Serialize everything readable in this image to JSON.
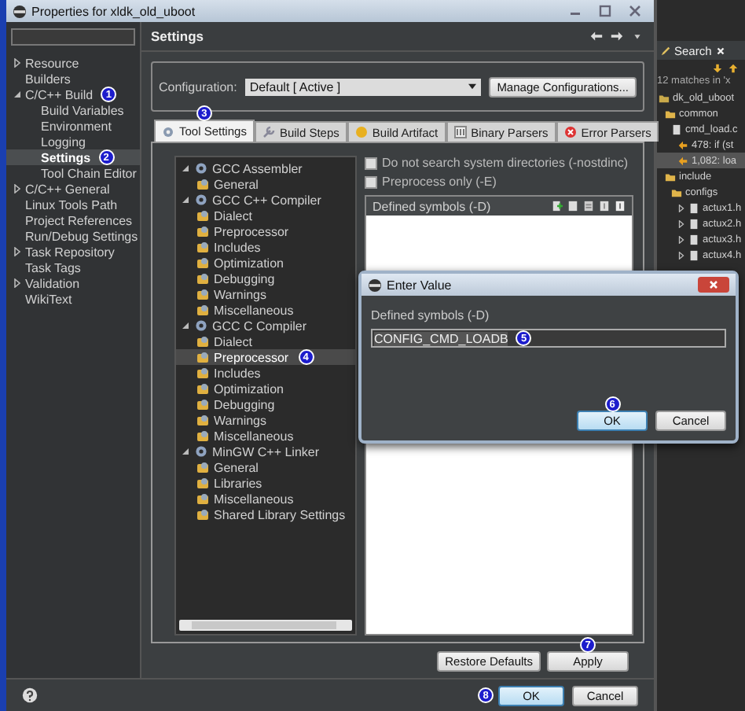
{
  "window": {
    "title": "Properties for xldk_old_uboot"
  },
  "nav": [
    {
      "label": "Resource",
      "expanded": false
    },
    {
      "label": "Builders"
    },
    {
      "label": "C/C++ Build",
      "expanded": true,
      "badge": "1",
      "children": [
        {
          "label": "Build Variables",
          "selected": false
        },
        {
          "label": "Environment",
          "selected": false
        },
        {
          "label": "Logging",
          "selected": false
        },
        {
          "label": "Settings",
          "selected": true,
          "badge": "2"
        },
        {
          "label": "Tool Chain Editor",
          "selected": false
        }
      ]
    },
    {
      "label": "C/C++ General",
      "expanded": false
    },
    {
      "label": "Linux Tools Path"
    },
    {
      "label": "Project References"
    },
    {
      "label": "Run/Debug Settings"
    },
    {
      "label": "Task Repository",
      "expanded": false
    },
    {
      "label": "Task Tags"
    },
    {
      "label": "Validation",
      "expanded": false
    },
    {
      "label": "WikiText"
    }
  ],
  "page": {
    "title": "Settings"
  },
  "configuration": {
    "label": "Configuration:",
    "value": "Default  [ Active ]",
    "manage_button": "Manage Configurations..."
  },
  "tabs": [
    {
      "label": "Tool Settings",
      "selected": true,
      "badge": "3"
    },
    {
      "label": "Build Steps",
      "selected": false
    },
    {
      "label": "Build Artifact",
      "selected": false
    },
    {
      "label": "Binary Parsers",
      "selected": false
    },
    {
      "label": "Error Parsers",
      "selected": false
    }
  ],
  "tool_tree": [
    {
      "label": "GCC Assembler",
      "expanded": true,
      "children": [
        {
          "label": "General",
          "selected": false
        }
      ]
    },
    {
      "label": "GCC C++ Compiler",
      "expanded": true,
      "children": [
        {
          "label": "Dialect",
          "selected": false
        },
        {
          "label": "Preprocessor",
          "selected": false
        },
        {
          "label": "Includes",
          "selected": false
        },
        {
          "label": "Optimization",
          "selected": false
        },
        {
          "label": "Debugging",
          "selected": false
        },
        {
          "label": "Warnings",
          "selected": false
        },
        {
          "label": "Miscellaneous",
          "selected": false
        }
      ]
    },
    {
      "label": "GCC C Compiler",
      "expanded": true,
      "children": [
        {
          "label": "Dialect",
          "selected": false
        },
        {
          "label": "Preprocessor",
          "selected": true,
          "badge": "4"
        },
        {
          "label": "Includes",
          "selected": false
        },
        {
          "label": "Optimization",
          "selected": false
        },
        {
          "label": "Debugging",
          "selected": false
        },
        {
          "label": "Warnings",
          "selected": false
        },
        {
          "label": "Miscellaneous",
          "selected": false
        }
      ]
    },
    {
      "label": "MinGW C++ Linker",
      "expanded": true,
      "children": [
        {
          "label": "General",
          "selected": false
        },
        {
          "label": "Libraries",
          "selected": false
        },
        {
          "label": "Miscellaneous",
          "selected": false
        },
        {
          "label": "Shared Library Settings",
          "selected": false
        }
      ]
    }
  ],
  "options": [
    {
      "label": "Do not search system directories (-nostdinc)",
      "checked": false
    },
    {
      "label": "Preprocess only (-E)",
      "checked": false
    }
  ],
  "symbols_list": {
    "title": "Defined symbols (-D)"
  },
  "page_buttons": [
    {
      "label": "Restore Defaults"
    },
    {
      "label": "Apply",
      "badge": "7"
    }
  ],
  "footer_buttons": [
    {
      "label": "OK",
      "default": true,
      "badge": "8"
    },
    {
      "label": "Cancel",
      "default": false
    }
  ],
  "search_view": {
    "tab": "Search",
    "summary": "12 matches in 'x",
    "tree": [
      {
        "label": "dk_old_uboot",
        "kind": "project",
        "children": [
          {
            "label": "common",
            "kind": "folder",
            "children": [
              {
                "label": "cmd_load.c",
                "kind": "file",
                "children": [
                  {
                    "label": "478: if (st",
                    "kind": "match",
                    "selected": false
                  },
                  {
                    "label": "1,082: loa",
                    "kind": "match",
                    "selected": true
                  }
                ]
              }
            ]
          },
          {
            "label": "include",
            "kind": "folder",
            "children": [
              {
                "label": "configs",
                "kind": "folder",
                "children": [
                  {
                    "label": "actux1.h",
                    "kind": "file",
                    "expanded": false
                  },
                  {
                    "label": "actux2.h",
                    "kind": "file",
                    "expanded": false
                  },
                  {
                    "label": "actux3.h",
                    "kind": "file",
                    "expanded": false
                  },
                  {
                    "label": "actux4.h",
                    "kind": "file",
                    "expanded": false
                  }
                ]
              }
            ]
          }
        ]
      }
    ]
  },
  "dialog": {
    "title": "Enter Value",
    "label": "Defined symbols (-D)",
    "value": "CONFIG_CMD_LOADB",
    "badge": "5",
    "buttons": [
      {
        "label": "OK",
        "default": true,
        "badge": "6"
      },
      {
        "label": "Cancel",
        "default": false
      }
    ]
  }
}
